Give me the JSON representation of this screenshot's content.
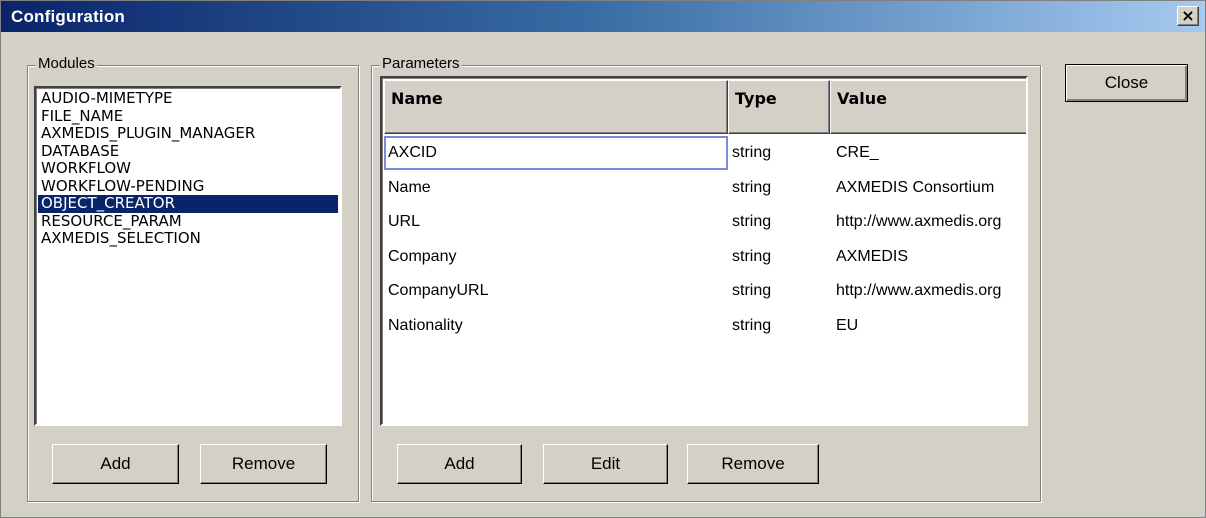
{
  "window": {
    "title": "Configuration",
    "close_glyph": "×"
  },
  "modules": {
    "label": "Modules",
    "items": [
      "AUDIO-MIMETYPE",
      "FILE_NAME",
      "AXMEDIS_PLUGIN_MANAGER",
      "DATABASE",
      "WORKFLOW",
      "WORKFLOW-PENDING",
      "OBJECT_CREATOR",
      "RESOURCE_PARAM",
      "AXMEDIS_SELECTION"
    ],
    "selected": "OBJECT_CREATOR",
    "add_label": "Add",
    "remove_label": "Remove"
  },
  "parameters": {
    "label": "Parameters",
    "columns": [
      "Name",
      "Type",
      "Value"
    ],
    "rows": [
      {
        "name": "AXCID",
        "type": "string",
        "value": "CRE_"
      },
      {
        "name": "Name",
        "type": "string",
        "value": "AXMEDIS Consortium"
      },
      {
        "name": "URL",
        "type": "string",
        "value": "http://www.axmedis.org"
      },
      {
        "name": "Company",
        "type": "string",
        "value": "AXMEDIS"
      },
      {
        "name": "CompanyURL",
        "type": "string",
        "value": "http://www.axmedis.org"
      },
      {
        "name": "Nationality",
        "type": "string",
        "value": "EU"
      }
    ],
    "add_label": "Add",
    "edit_label": "Edit",
    "remove_label": "Remove"
  },
  "close_label": "Close",
  "colors": {
    "title_gradient_start": "#0a246a",
    "title_gradient_end": "#a6caf0",
    "selection": "#0a246a",
    "focus_border": "#7b89d9",
    "face": "#d4d0c8"
  },
  "icons": {
    "title_close": "close-icon",
    "scroll_left": "arrow-left-icon",
    "scroll_right": "arrow-right-icon"
  }
}
